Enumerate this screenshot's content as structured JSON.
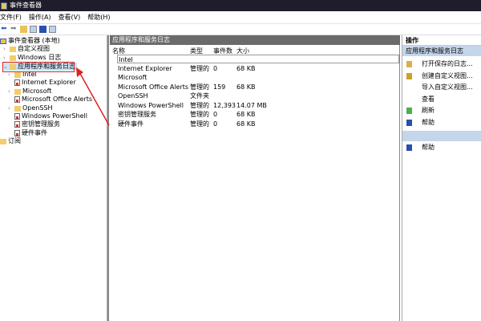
{
  "window": {
    "title": "事件查看器"
  },
  "menu": [
    "文件(F)",
    "操作(A)",
    "查看(V)",
    "帮助(H)"
  ],
  "tree": [
    {
      "label": "事件查看器 (本地)",
      "icon": "event-viewer-icon",
      "level": 0
    },
    {
      "label": "自定义视图",
      "icon": "folder-icon",
      "level": 1,
      "expander": true
    },
    {
      "label": "Windows 日志",
      "icon": "folder-icon",
      "level": 1,
      "expander": true
    },
    {
      "label": "应用程序和服务日志",
      "icon": "folder-icon",
      "level": 1,
      "expander": true,
      "selected": true
    },
    {
      "label": "Intel",
      "icon": "folder-icon",
      "level": 2,
      "expander": true
    },
    {
      "label": "Internet Explorer",
      "icon": "log-icon",
      "level": 2
    },
    {
      "label": "Microsoft",
      "icon": "folder-icon",
      "level": 2,
      "expander": true
    },
    {
      "label": "Microsoft Office Alerts",
      "icon": "log-icon",
      "level": 2
    },
    {
      "label": "OpenSSH",
      "icon": "folder-icon",
      "level": 2,
      "expander": true
    },
    {
      "label": "Windows PowerShell",
      "icon": "log-icon",
      "level": 2
    },
    {
      "label": "密钥管理服务",
      "icon": "log-icon",
      "level": 2
    },
    {
      "label": "硬件事件",
      "icon": "log-icon",
      "level": 2
    },
    {
      "label": "订阅",
      "icon": "subscription-icon",
      "level": 0
    }
  ],
  "main": {
    "header": "应用程序和服务日志",
    "columns": [
      "名称",
      "类型",
      "事件数",
      "大小"
    ],
    "rows": [
      [
        "Intel",
        "",
        "",
        ""
      ],
      [
        "Internet Explorer",
        "管理的",
        "0",
        "68 KB"
      ],
      [
        "Microsoft",
        "",
        "",
        ""
      ],
      [
        "Microsoft Office Alerts",
        "管理的",
        "159",
        "68 KB"
      ],
      [
        "OpenSSH",
        "文件夹",
        "",
        ""
      ],
      [
        "Windows PowerShell",
        "管理的",
        "12,393",
        "14.07 MB"
      ],
      [
        "密钥管理服务",
        "管理的",
        "0",
        "68 KB"
      ],
      [
        "硬件事件",
        "管理的",
        "0",
        "68 KB"
      ]
    ]
  },
  "actions": {
    "header": "操作",
    "section1": "应用程序和服务日志",
    "items": [
      {
        "label": "打开保存的日志...",
        "icon": "open-log-icon"
      },
      {
        "label": "创建自定义视图...",
        "icon": "filter-icon"
      },
      {
        "label": "导入自定义视图...",
        "icon": ""
      },
      {
        "label": "查看",
        "icon": ""
      },
      {
        "label": "刷新",
        "icon": "refresh-icon"
      },
      {
        "label": "帮助",
        "icon": "help-icon"
      }
    ],
    "section2": "",
    "items2": [
      {
        "label": "帮助",
        "icon": "help-icon"
      }
    ]
  },
  "colors": {
    "titlebar": "#1f1d2b",
    "annotation": "#e02020",
    "section": "#c5d5ea"
  }
}
